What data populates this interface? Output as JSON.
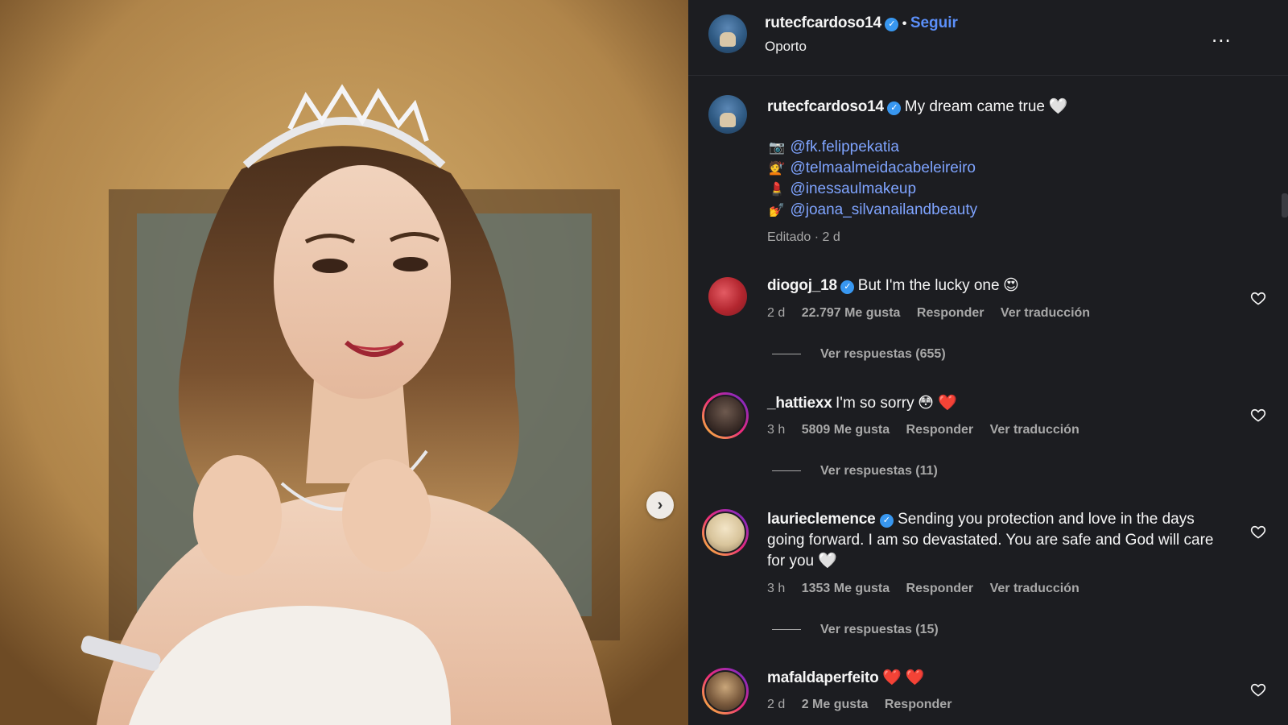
{
  "header": {
    "username": "rutecfcardoso14",
    "separator": "•",
    "follow_label": "Seguir",
    "location": "Oporto",
    "more_label": "..."
  },
  "caption": {
    "username": "rutecfcardoso14",
    "text": "My dream came true",
    "heart_emoji": "🤍",
    "credits": [
      {
        "icon": "📷",
        "handle": "@fk.felippekatia"
      },
      {
        "icon": "💇",
        "handle": "@telmaalmeidacabeleireiro"
      },
      {
        "icon": "💄",
        "handle": "@inessaulmakeup"
      },
      {
        "icon": "💅",
        "handle": "@joana_silvanailandbeauty"
      }
    ],
    "edited": "Editado · 2 d"
  },
  "comments": [
    {
      "username": "diogoj_18",
      "verified": true,
      "text": "But I'm the lucky one",
      "emoji": "😍",
      "time": "2 d",
      "likes": "22.797 Me gusta",
      "reply": "Responder",
      "translate": "Ver traducción",
      "replies": "Ver respuestas (655)"
    },
    {
      "username": "_hattiexx",
      "verified": false,
      "text": "I'm so sorry",
      "emoji": "😳 ❤️",
      "time": "3 h",
      "likes": "5809 Me gusta",
      "reply": "Responder",
      "translate": "Ver traducción",
      "replies": "Ver respuestas (11)"
    },
    {
      "username": "laurieclemence",
      "verified": true,
      "text": "Sending you protection and love in the days going forward. I am so devastated. You are safe and God will care for you",
      "emoji": "🤍",
      "time": "3 h",
      "likes": "1353 Me gusta",
      "reply": "Responder",
      "translate": "Ver traducción",
      "replies": "Ver respuestas (15)"
    },
    {
      "username": "mafaldaperfeito",
      "verified": false,
      "text": "",
      "emoji": "❤️ ❤️",
      "time": "2 d",
      "likes": "2 Me gusta",
      "reply": "Responder"
    }
  ],
  "icons": {
    "verified": "verified-badge-icon",
    "heart": "heart-outline-icon",
    "next": "chevron-right-icon",
    "more": "more-horizontal-icon"
  },
  "colors": {
    "panel_bg": "#1c1d21",
    "link_blue": "#5b8ff9",
    "mention_blue": "#7fa4ff",
    "verified_blue": "#3897f0",
    "secondary_text": "#a8a8a8"
  }
}
